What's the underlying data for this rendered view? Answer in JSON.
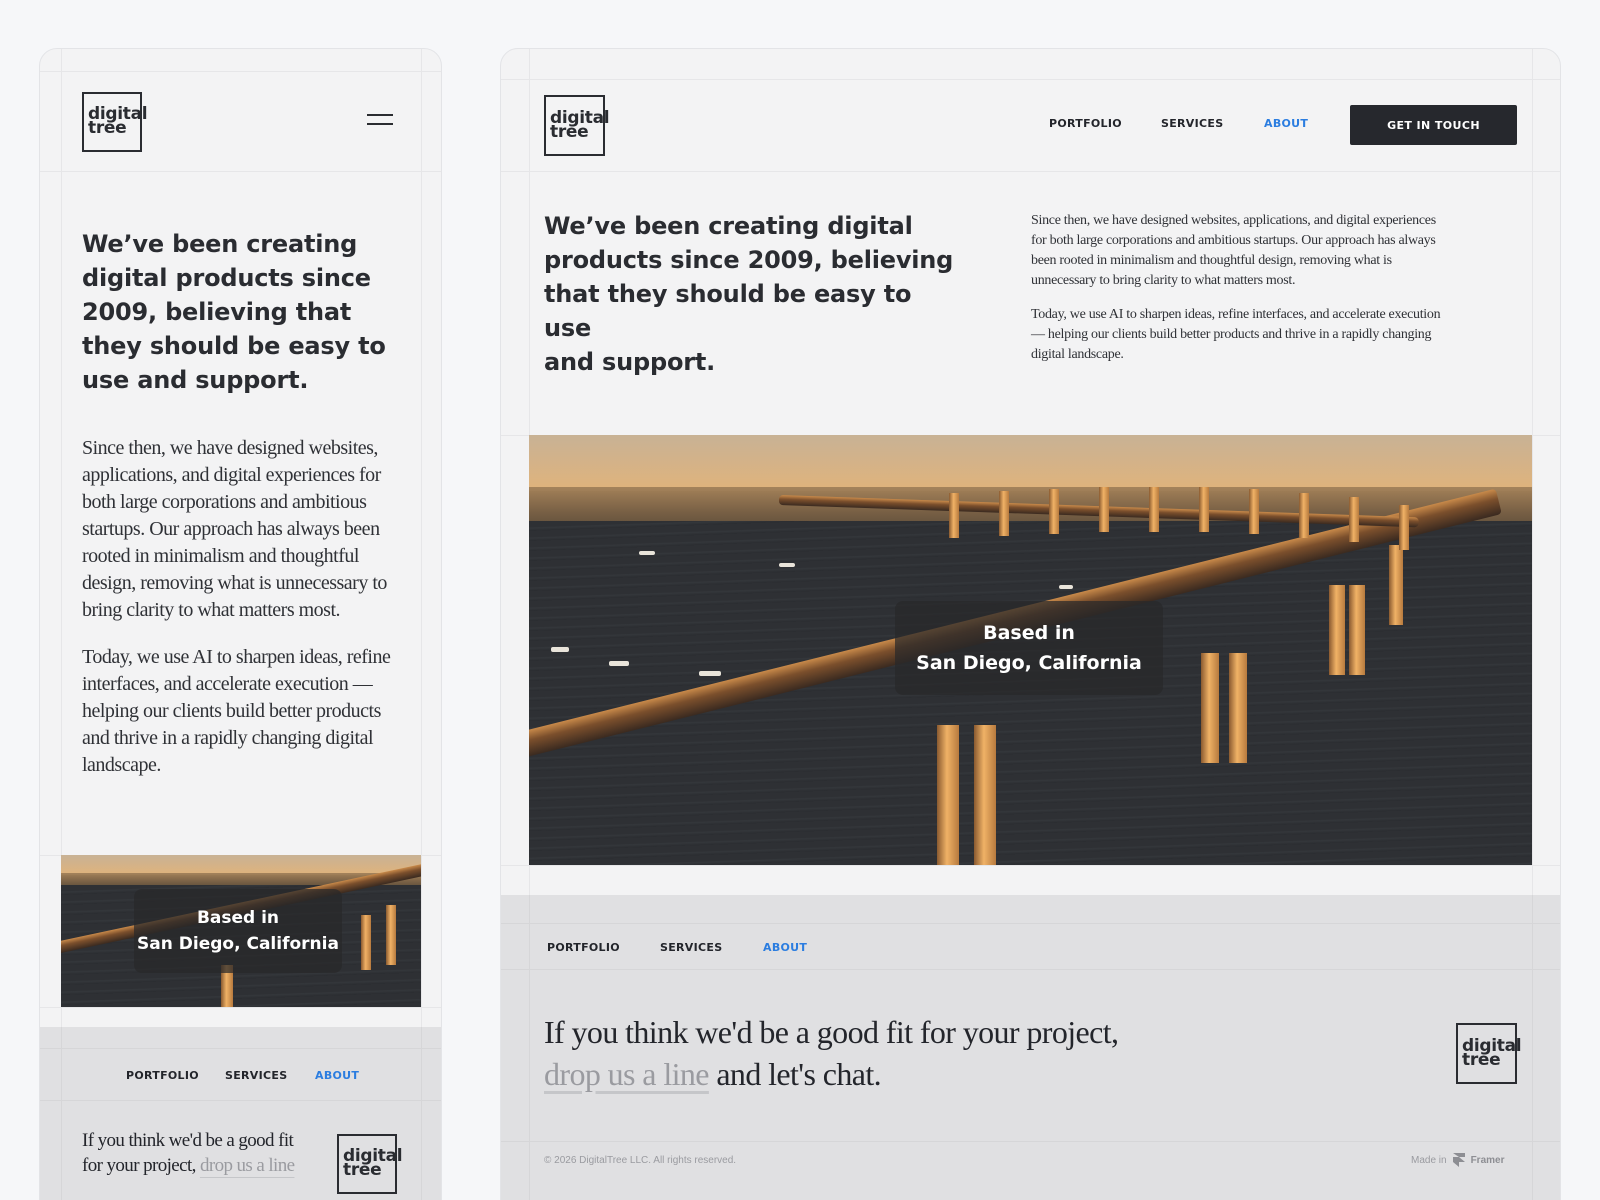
{
  "brand": {
    "logo_line1": "digital",
    "logo_line2": "tree"
  },
  "nav": {
    "portfolio": "PORTFOLIO",
    "services": "SERVICES",
    "about": "ABOUT",
    "cta": "GET IN TOUCH",
    "active_color": "#2b7de0"
  },
  "hero": {
    "title_mobile": [
      "We’ve been creating",
      "digital products since",
      "2009, believing that",
      "they should be easy to",
      "use and support."
    ],
    "title_desktop": [
      "We’ve been creating digital",
      "products since 2009, believing",
      "that they should be easy to use",
      "and support."
    ],
    "paragraph1": "Since then, we have designed websites, applications, and digital experiences for both large corporations and ambitious startups. Our approach has always been rooted in minimalism and thoughtful design, removing what is unnecessary to bring clarity to what matters most.",
    "paragraph2": "Today, we use AI to sharpen ideas, refine interfaces, and accelerate execution — helping our clients build better products and thrive in a rapidly changing digital landscape."
  },
  "location": {
    "line1": "Based in",
    "line2": "San Diego, California"
  },
  "footer": {
    "cta_before": "If you think we'd be a good fit for your project,",
    "cta_link": "drop us a line",
    "cta_after": "and let's chat.",
    "mobile_line1": "If you think we'd be a good fit",
    "mobile_line2_before": "for your project,",
    "copyright": "© 2026 DigitalTree LLC. All rights reserved.",
    "made_in": "Made in",
    "framer": "Framer"
  },
  "icons": {
    "menu": "hamburger-icon",
    "framer": "framer-logo-icon"
  }
}
